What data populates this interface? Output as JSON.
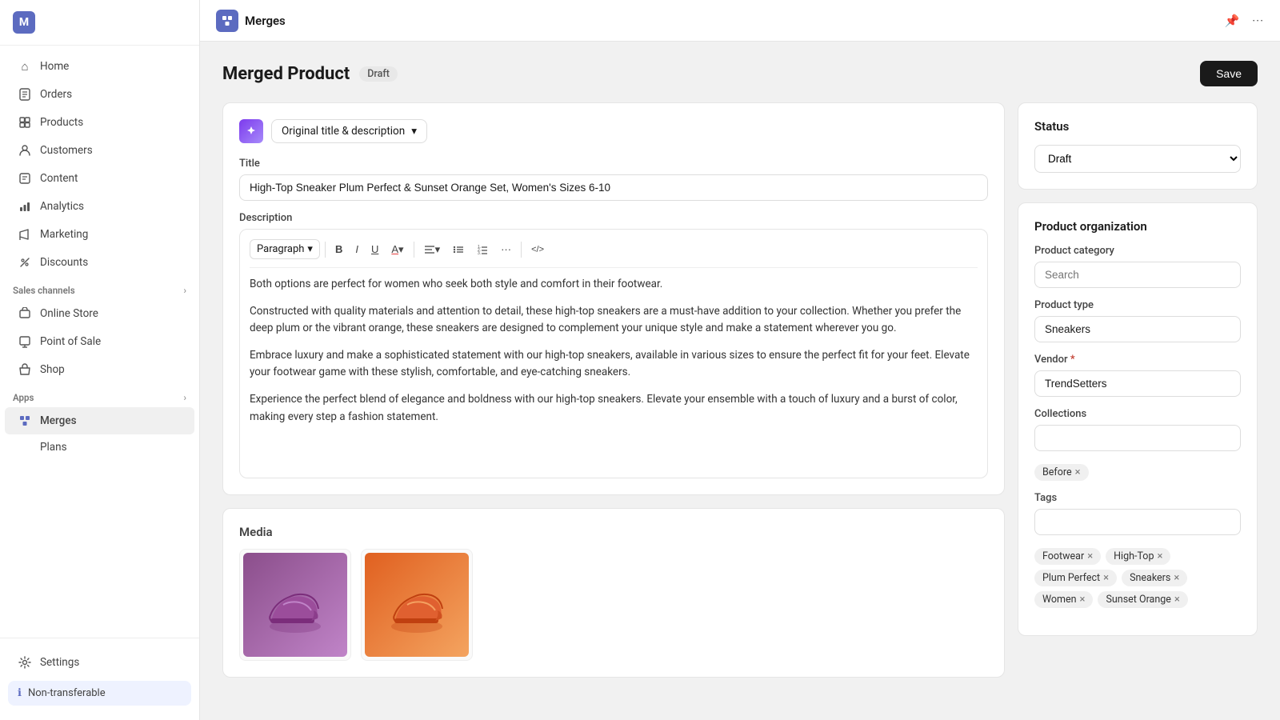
{
  "sidebar": {
    "logo": "M",
    "nav_items": [
      {
        "id": "home",
        "label": "Home",
        "icon": "⌂"
      },
      {
        "id": "orders",
        "label": "Orders",
        "icon": "📋"
      },
      {
        "id": "products",
        "label": "Products",
        "icon": "📦"
      },
      {
        "id": "customers",
        "label": "Customers",
        "icon": "👤"
      },
      {
        "id": "content",
        "label": "Content",
        "icon": "📄"
      },
      {
        "id": "analytics",
        "label": "Analytics",
        "icon": "📊"
      },
      {
        "id": "marketing",
        "label": "Marketing",
        "icon": "📢"
      },
      {
        "id": "discounts",
        "label": "Discounts",
        "icon": "🏷"
      }
    ],
    "sales_channels_label": "Sales channels",
    "sales_channels": [
      {
        "id": "online-store",
        "label": "Online Store",
        "icon": "🏪"
      },
      {
        "id": "point-of-sale",
        "label": "Point of Sale",
        "icon": "🖥"
      },
      {
        "id": "shop",
        "label": "Shop",
        "icon": "🛍"
      }
    ],
    "apps_label": "Apps",
    "apps": [
      {
        "id": "merges",
        "label": "Merges",
        "icon": "⧖",
        "active": true
      },
      {
        "id": "plans",
        "label": "Plans",
        "icon": ""
      }
    ],
    "settings_label": "Settings",
    "non_transferable": "Non-transferable"
  },
  "topbar": {
    "app_name": "Merges",
    "pin_icon": "📌",
    "more_icon": "···"
  },
  "page": {
    "title": "Merged Product",
    "badge": "Draft",
    "save_button": "Save"
  },
  "ai_selector": {
    "label": "Original title & description"
  },
  "title_field": {
    "label": "Title",
    "value": "High-Top Sneaker Plum Perfect & Sunset Orange Set, Women's Sizes 6-10"
  },
  "description_field": {
    "label": "Description",
    "toolbar": {
      "paragraph_label": "Paragraph",
      "bold": "B",
      "italic": "I",
      "underline": "U",
      "text_color": "A",
      "align": "≡",
      "bullet": "☰",
      "ordered": "☷",
      "more": "···",
      "code": "</>"
    },
    "paragraphs": [
      "Both options are perfect for women who seek both style and comfort in their footwear.",
      "Constructed with quality materials and attention to detail, these high-top sneakers are a must-have addition to your collection. Whether you prefer the deep plum or the vibrant orange, these sneakers are designed to complement your unique style and make a statement wherever you go.",
      "Embrace luxury and make a sophisticated statement with our high-top sneakers, available in various sizes to ensure the perfect fit for your feet. Elevate your footwear game with these stylish, comfortable, and eye-catching sneakers.",
      "Experience the perfect blend of elegance and boldness with our high-top sneakers. Elevate your ensemble with a touch of luxury and a burst of color, making every step a fashion statement."
    ]
  },
  "media": {
    "label": "Media"
  },
  "status_panel": {
    "title": "Status",
    "status_value": "Draft"
  },
  "product_org": {
    "title": "Product organization",
    "category_label": "Product category",
    "category_placeholder": "Search",
    "type_label": "Product type",
    "type_value": "Sneakers",
    "vendor_label": "Vendor",
    "vendor_required": true,
    "vendor_value": "TrendSetters",
    "collections_label": "Collections",
    "collection_tag": "Before",
    "tags_label": "Tags",
    "tags_placeholder": "",
    "tags": [
      "Footwear",
      "High-Top",
      "Plum Perfect",
      "Sneakers",
      "Women",
      "Sunset Orange"
    ]
  }
}
